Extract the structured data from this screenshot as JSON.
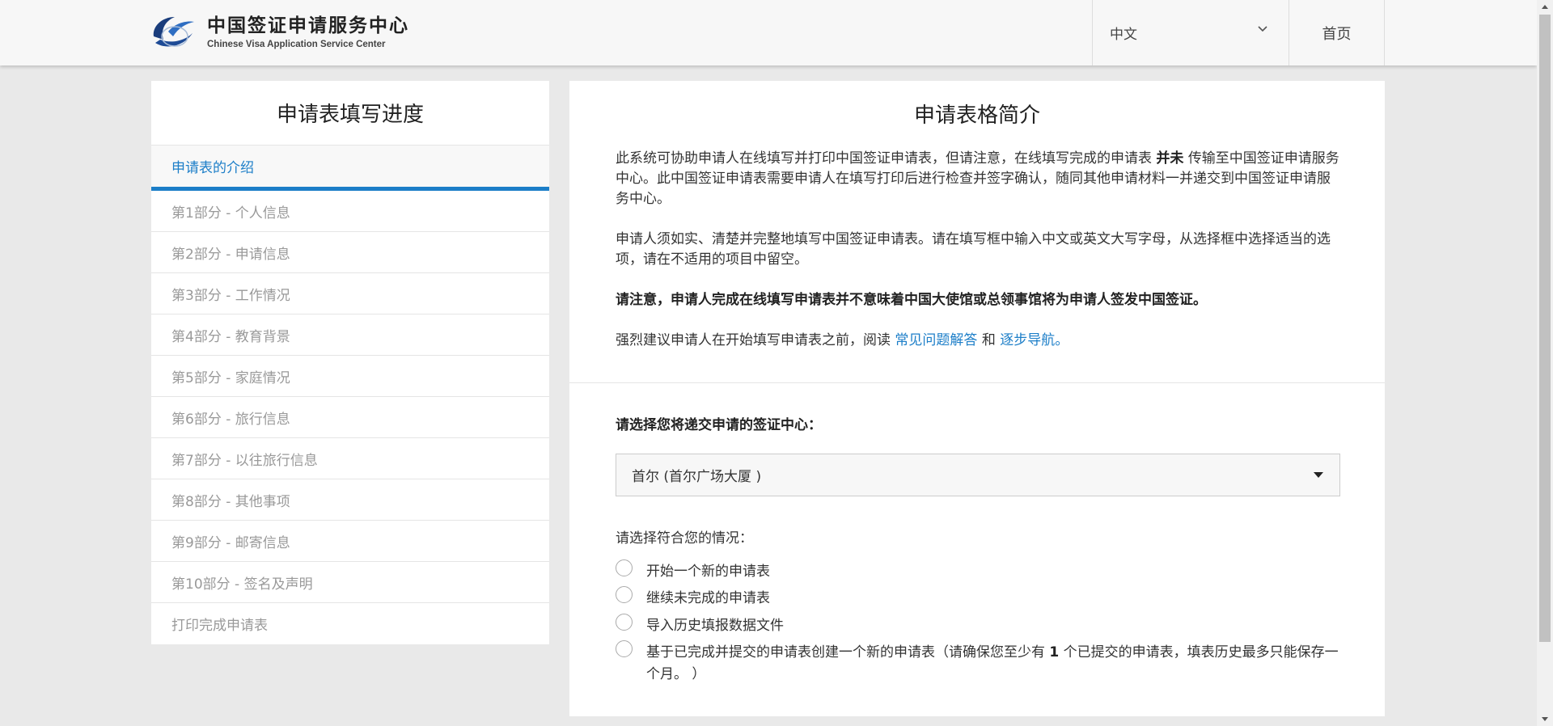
{
  "header": {
    "logo_cn": "中国签证申请服务中心",
    "logo_en": "Chinese Visa Application Service Center",
    "language": "中文",
    "home": "首页"
  },
  "sidebar": {
    "title": "申请表填写进度",
    "items": [
      {
        "label": "申请表的介绍",
        "active": true
      },
      {
        "label": "第1部分 - 个人信息"
      },
      {
        "label": "第2部分 - 申请信息"
      },
      {
        "label": "第3部分 - 工作情况"
      },
      {
        "label": "第4部分 - 教育背景"
      },
      {
        "label": "第5部分 - 家庭情况"
      },
      {
        "label": "第6部分 - 旅行信息"
      },
      {
        "label": "第7部分 - 以往旅行信息"
      },
      {
        "label": "第8部分 - 其他事项"
      },
      {
        "label": "第9部分 - 邮寄信息"
      },
      {
        "label": "第10部分 - 签名及声明"
      },
      {
        "label": "打印完成申请表"
      }
    ]
  },
  "main": {
    "title": "申请表格简介",
    "p1_a": "此系统可协助申请人在线填写并打印中国签证申请表，但请注意，在线填写完成的申请表",
    "p1_b": "并未",
    "p1_c": "传输至中国签证申请服务中心。此中国签证申请表需要申请人在填写打印后进行检查并签字确认，随同其他申请材料一并递交到中国签证申请服务中心。",
    "p2": "申请人须如实、清楚并完整地填写中国签证申请表。请在填写框中输入中文或英文大写字母，从选择框中选择适当的选项，请在不适用的项目中留空。",
    "p3": "请注意，申请人完成在线填写申请表并不意味着中国大使馆或总领事馆将为申请人签发中国签证。",
    "p4_a": "强烈建议申请人在开始填写申请表之前，阅读",
    "p4_link1": "常见问题解答",
    "p4_b": "和",
    "p4_link2": "逐步导航。",
    "center_label": "请选择您将递交申请的签证中心：",
    "center_value": "首尔 (首尔广场大厦 )",
    "situation_label": "请选择符合您的情况：",
    "options": [
      "开始一个新的申请表",
      "继续未完成的申请表",
      "导入历史填报数据文件"
    ],
    "option4_a": "基于已完成并提交的申请表创建一个新的申请表（请确保您至少有",
    "option4_b": "1",
    "option4_c": "个已提交的申请表，填表历史最多只能保存一个月。 ）"
  },
  "colors": {
    "accent": "#1c7ec8",
    "background": "#e9e9e9"
  }
}
